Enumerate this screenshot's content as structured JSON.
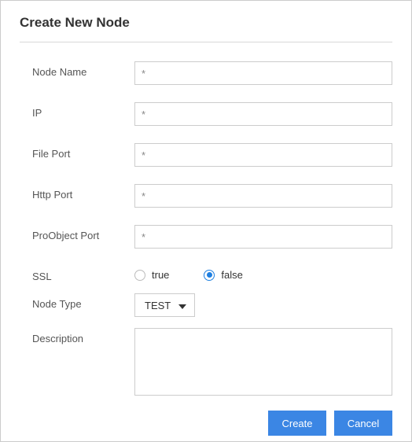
{
  "title": "Create New Node",
  "form": {
    "nodeName": {
      "label": "Node Name",
      "placeholder": "*",
      "value": ""
    },
    "ip": {
      "label": "IP",
      "placeholder": "*",
      "value": ""
    },
    "filePort": {
      "label": "File Port",
      "placeholder": "*",
      "value": ""
    },
    "httpPort": {
      "label": "Http Port",
      "placeholder": "*",
      "value": ""
    },
    "proObjectPort": {
      "label": "ProObject Port",
      "placeholder": "*",
      "value": ""
    },
    "ssl": {
      "label": "SSL",
      "options": {
        "true": "true",
        "false": "false"
      },
      "value": "false"
    },
    "nodeType": {
      "label": "Node Type",
      "selected": "TEST"
    },
    "description": {
      "label": "Description",
      "value": ""
    }
  },
  "buttons": {
    "create": "Create",
    "cancel": "Cancel"
  }
}
